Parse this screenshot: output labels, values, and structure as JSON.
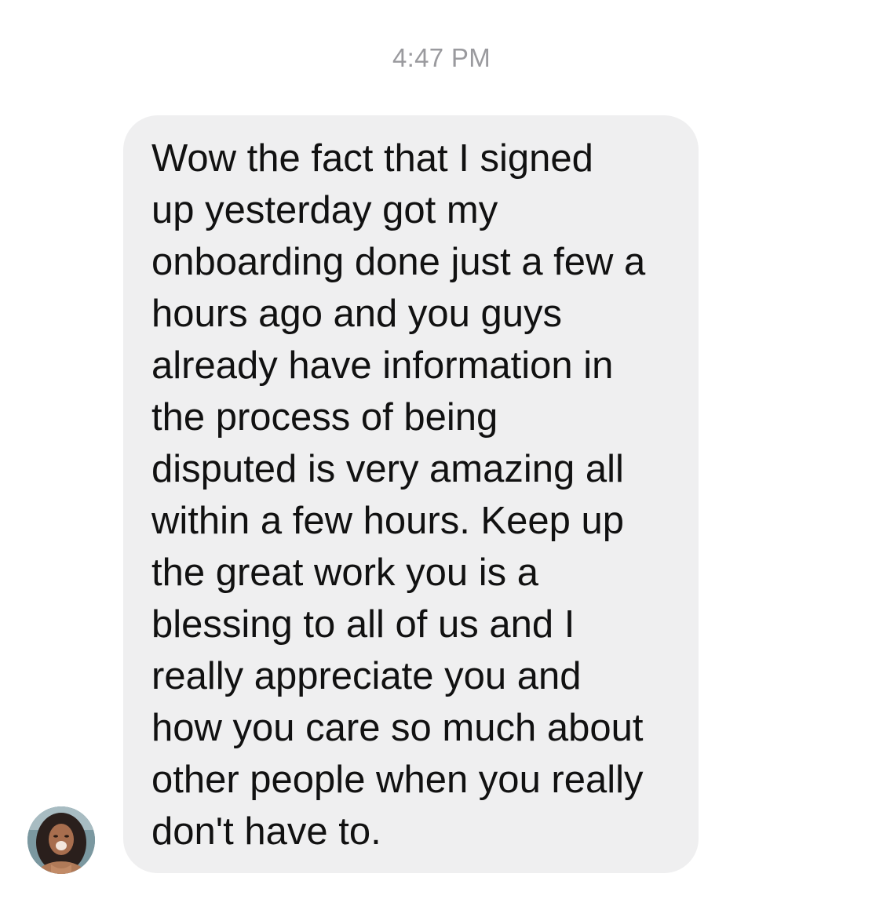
{
  "conversation": {
    "timestamp": "4:47 PM",
    "message": {
      "sender_avatar_icon": "user-avatar-photo",
      "text": "Wow  the fact that I signed\nup yesterday got my\nonboarding done just a few a\nhours ago and you guys\nalready have information in\nthe process of being\ndisputed is very amazing all\nwithin a few hours. Keep up\nthe great work you is a\nblessing to all of us and I\nreally appreciate you and\nhow you care so much about\nother people when you really\ndon't have to."
    }
  },
  "colors": {
    "background": "#ffffff",
    "bubble": "#efeff0",
    "timestamp": "#9a9a9e",
    "text": "#111111"
  }
}
